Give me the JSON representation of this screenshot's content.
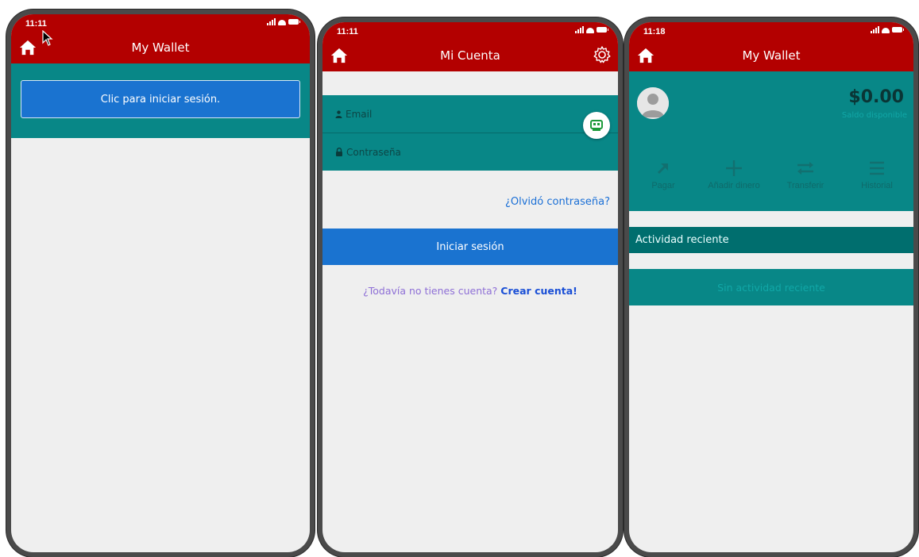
{
  "screens": [
    {
      "status_time": "11:11",
      "app_title": "My Wallet",
      "login_banner": "Clic para iniciar sesión."
    },
    {
      "status_time": "11:11",
      "app_title": "Mi Cuenta",
      "email_placeholder": "Email",
      "password_placeholder": "Contraseña",
      "forgot_link": "¿Olvidó contraseña?",
      "login_button": "Iniciar sesión",
      "signup_question": "¿Todavía no tienes cuenta?",
      "signup_link": "Crear cuenta!"
    },
    {
      "status_time": "11:18",
      "app_title": "My Wallet",
      "balance": "$0.00",
      "balance_label": "Saldo disponible",
      "actions": [
        {
          "label": "Pagar",
          "icon": "arrow-up-right-icon"
        },
        {
          "label": "Añadir dinero",
          "icon": "plus-icon"
        },
        {
          "label": "Transferir",
          "icon": "transfer-icon"
        },
        {
          "label": "Historial",
          "icon": "menu-icon"
        }
      ],
      "recent_activity_title": "Actividad reciente",
      "recent_activity_empty": "Sin actividad reciente"
    }
  ],
  "colors": {
    "header_red": "#b30000",
    "teal": "#088787",
    "dark_teal": "#006e6e",
    "primary_blue": "#1a73d0"
  }
}
